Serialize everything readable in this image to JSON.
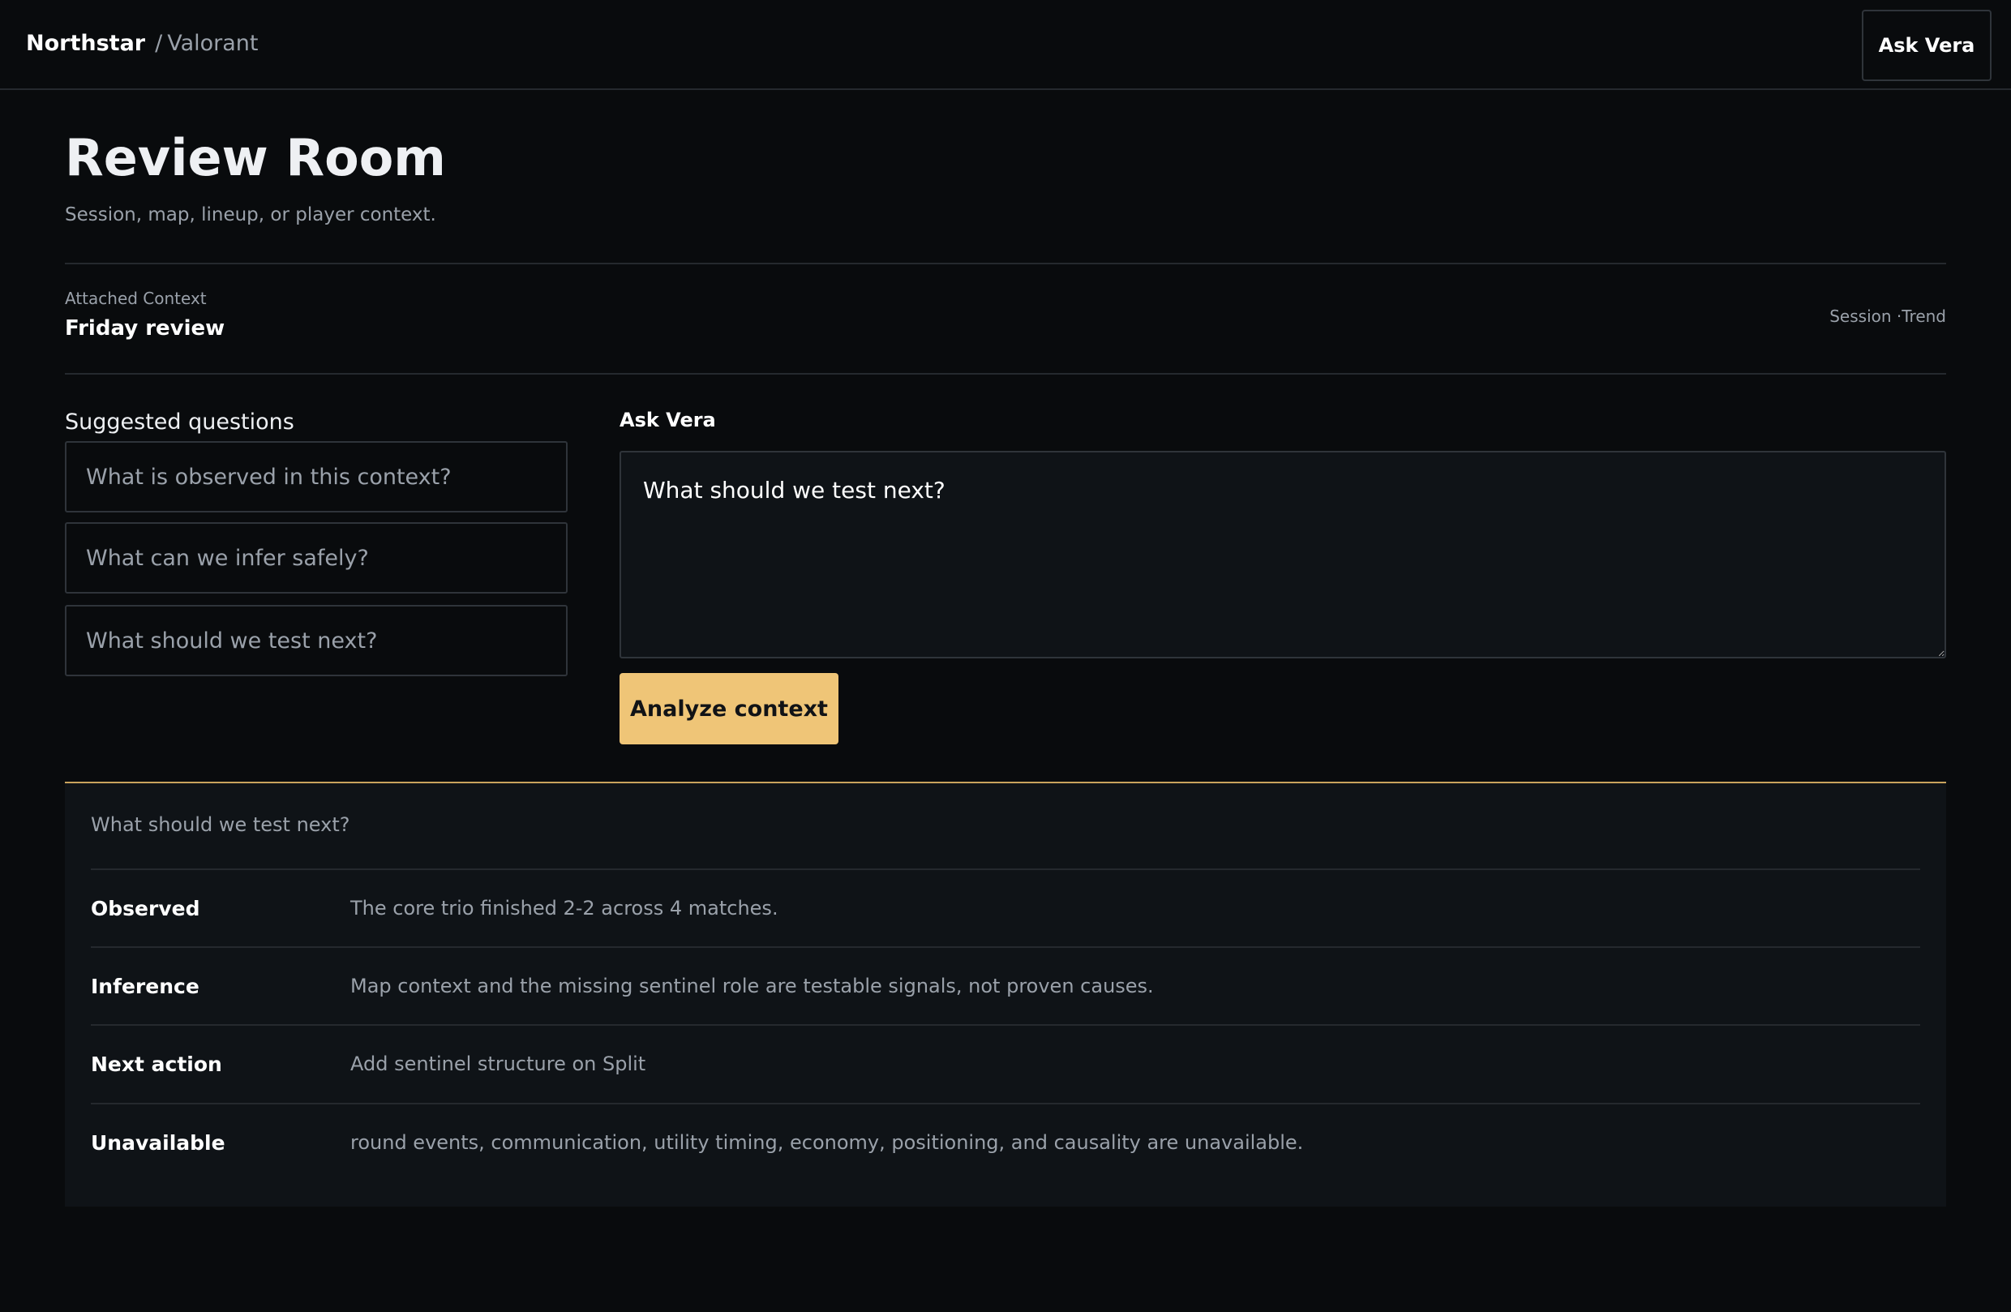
{
  "topbar": {
    "brand": "Northstar",
    "separator": "/",
    "game": "Valorant",
    "ask_button": "Ask Vera"
  },
  "header": {
    "title": "Review Room",
    "subtitle": "Session, map, lineup, or player context."
  },
  "context": {
    "label": "Attached Context",
    "value": "Friday review",
    "meta": "Session ·Trend"
  },
  "suggestions": {
    "heading": "Suggested questions",
    "items": [
      "What is observed in this context?",
      "What can we infer safely?",
      "What should we test next?"
    ]
  },
  "ask": {
    "label": "Ask Vera",
    "input_value": "What should we test next?",
    "analyze_label": "Analyze context"
  },
  "result": {
    "question": "What should we test next?",
    "rows": [
      {
        "key": "Observed",
        "value": "The core trio finished 2-2 across 4 matches."
      },
      {
        "key": "Inference",
        "value": "Map context and the missing sentinel role are testable signals, not proven causes."
      },
      {
        "key": "Next action",
        "value": "Add sentinel structure on Split"
      },
      {
        "key": "Unavailable",
        "value": "round events, communication, utility timing, economy, positioning, and causality are unavailable."
      }
    ]
  },
  "colors": {
    "background": "#090b0d",
    "panel": "#0f1317",
    "accent": "#efc577",
    "muted_text": "#9aa1aa"
  }
}
